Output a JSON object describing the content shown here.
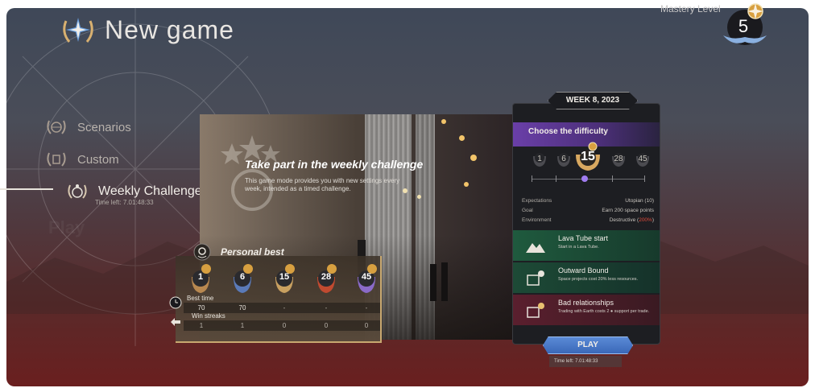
{
  "header": {
    "title": "New game",
    "mastery_label": "Mastery Level",
    "mastery_level": "5"
  },
  "menu": {
    "items": [
      {
        "label": "Scenarios"
      },
      {
        "label": "Custom"
      },
      {
        "label": "Weekly Challenge"
      }
    ],
    "active_time_left": "Time left: 7.01:48:33"
  },
  "challenge": {
    "title": "Take part in the weekly challenge",
    "description": "This game mode provides you with new settings every week, intended as a timed challenge."
  },
  "personal_best": {
    "title": "Personal best",
    "medals": [
      "1",
      "6",
      "15",
      "28",
      "45"
    ],
    "best_time_label": "Best time",
    "best_times": [
      "70",
      "70",
      "-",
      "-",
      "-"
    ],
    "win_streaks_label": "Win streaks",
    "win_streaks": [
      "1",
      "1",
      "0",
      "0",
      "0"
    ]
  },
  "week_panel": {
    "week_label": "WEEK 8, 2023",
    "difficulty_title": "Choose the difficulty",
    "difficulties": [
      "1",
      "6",
      "15",
      "28",
      "45"
    ],
    "selected_difficulty": "15",
    "stats": [
      {
        "label": "Expectations",
        "value": "Utopian (10)"
      },
      {
        "label": "Goal",
        "value": "Earn 200 space points"
      },
      {
        "label": "Environment",
        "value": "Destructive (",
        "highlight": "200%",
        "suffix": ")"
      }
    ],
    "modifiers": [
      {
        "title": "Lava Tube start",
        "desc": "Start in a Lava Tube.",
        "color": "#1f5a3e"
      },
      {
        "title": "Outward Bound",
        "desc": "Space projects cost 20% less resources.",
        "color": "#1d4a36"
      },
      {
        "title": "Bad relationships",
        "desc": "Trading with Earth costs 2 ● support per trade.",
        "color": "#5a1f2e"
      }
    ],
    "play_label": "PLAY",
    "play_time_left": "Time left: 7.01:48:33"
  },
  "colors": {
    "accent_purple": "#6a3fa8",
    "play_blue": "#3a68b8",
    "gold": "#c8a870"
  }
}
